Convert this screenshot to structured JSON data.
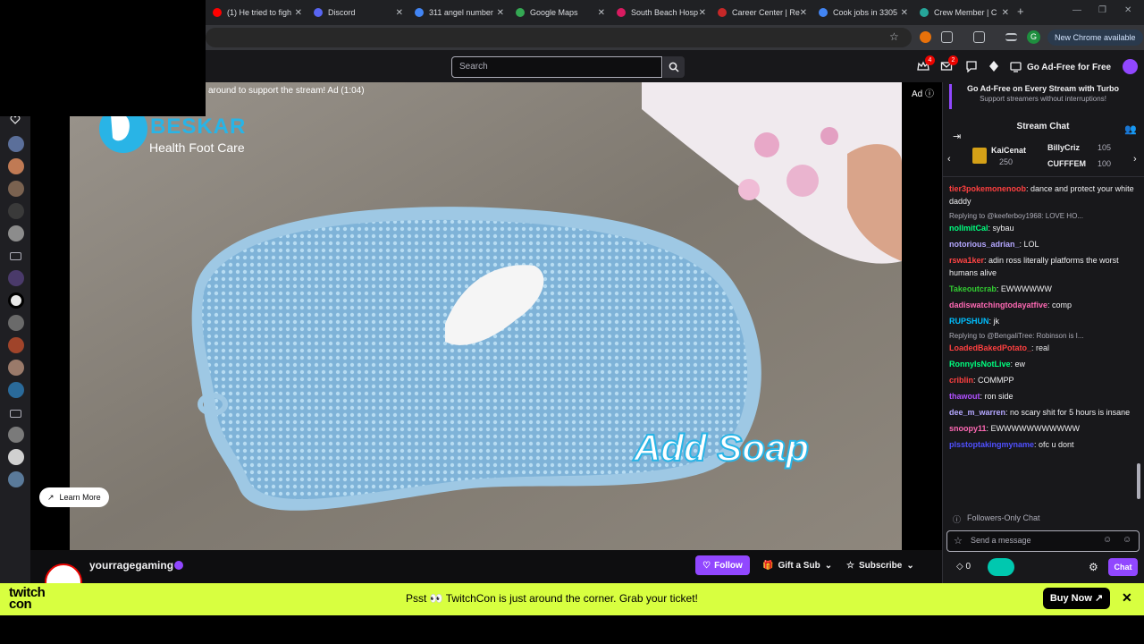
{
  "browser": {
    "tabs": [
      {
        "label": "(1) He tried to figh",
        "color": "#ff0000"
      },
      {
        "label": "Discord",
        "color": "#5865f2"
      },
      {
        "label": "311 angel number",
        "color": "#4285f4"
      },
      {
        "label": "Google Maps",
        "color": "#34a853"
      },
      {
        "label": "South Beach Hosp",
        "color": "#d81b60"
      },
      {
        "label": "Career Center | Re",
        "color": "#c62828"
      },
      {
        "label": "Cook jobs in 3305",
        "color": "#4285f4"
      },
      {
        "label": "Crew Member | C",
        "color": "#26a69a"
      }
    ],
    "new_tab": "+",
    "new_chrome_label": "New Chrome available",
    "profile_initial": "G"
  },
  "topnav": {
    "search_placeholder": "Search",
    "notifications_count": "4",
    "whispers_count": "2",
    "go_ad_free": "Go Ad-Free for Free"
  },
  "player": {
    "ad_banner": "around to support the stream! Ad (1:04)",
    "ad_tag": "Ad",
    "learn_more": "Learn More",
    "brand_name": "BESKAR",
    "brand_sub": "Health Foot Care",
    "overlay_text": "Add Soap"
  },
  "stream_info": {
    "channel_name": "yourragegaming",
    "follow": "Follow",
    "gift": "Gift a Sub",
    "subscribe": "Subscribe"
  },
  "chat": {
    "promo_title": "Go Ad-Free on Every Stream with Turbo",
    "promo_sub": "Support streamers without interruptions!",
    "title": "Stream Chat",
    "leaderboard": [
      {
        "name": "KaiCenat",
        "count": "250"
      },
      {
        "name": "BillyCriz",
        "count": "105"
      },
      {
        "name": "CUFFFEM",
        "count": "100"
      }
    ],
    "messages": [
      {
        "type": "msg",
        "user": "tier3pokemonenoob",
        "color": "#ff4040",
        "text": ": dance and protect your white daddy"
      },
      {
        "type": "reply",
        "text": "Replying to @keeferboy1968: LOVE HO..."
      },
      {
        "type": "msg",
        "user": "nollmitCal",
        "color": "#00ff7f",
        "text": ": sybau"
      },
      {
        "type": "msg",
        "user": "notorious_adrian_",
        "color": "#b4a7ff",
        "text": ": LOL"
      },
      {
        "type": "msg",
        "user": "rswa1ker",
        "color": "#ff4444",
        "text": ": adin ross literally platforms the worst humans alive"
      },
      {
        "type": "msg",
        "user": "Takeoutcrab",
        "color": "#32cd32",
        "text": ": EWWWWWW"
      },
      {
        "type": "msg",
        "user": "dadiswatchingtodayatfive",
        "color": "#ff69b4",
        "text": ": comp"
      },
      {
        "type": "msg",
        "user": "RUPSHUN",
        "color": "#00bfff",
        "text": ": jk"
      },
      {
        "type": "reply",
        "text": "Replying to @BengaliTree: Robinson is I..."
      },
      {
        "type": "msg",
        "user": "LoadedBakedPotato_",
        "color": "#ff4040",
        "text": ": real"
      },
      {
        "type": "msg",
        "user": "RonnyIsNotLive",
        "color": "#00ff7f",
        "text": ": ew"
      },
      {
        "type": "msg",
        "user": "criblin",
        "color": "#ff4040",
        "text": ": COMMPP"
      },
      {
        "type": "msg",
        "user": "thawout",
        "color": "#b050ff",
        "text": ": ron side"
      },
      {
        "type": "msg",
        "user": "dee_m_warren",
        "color": "#b4a7ff",
        "text": ": no scary shit for 5 hours is insane"
      },
      {
        "type": "msg",
        "user": "snoopy11",
        "color": "#ff69b4",
        "text": ": EWWWWWWWWWWW"
      },
      {
        "type": "msg",
        "user": "plsstoptakingmyname",
        "color": "#5050ff",
        "text": ": ofc u dont"
      }
    ],
    "followers_only": "Followers-Only Chat",
    "input_placeholder": "Send a message",
    "points": "0",
    "chat_button": "Chat"
  },
  "banner": {
    "logo_line1": "twitch",
    "logo_line2": "con",
    "text": "Psst 👀 TwitchCon is just around the corner. Grab your ticket!",
    "buy_now": "Buy Now ↗",
    "close": "✕"
  }
}
